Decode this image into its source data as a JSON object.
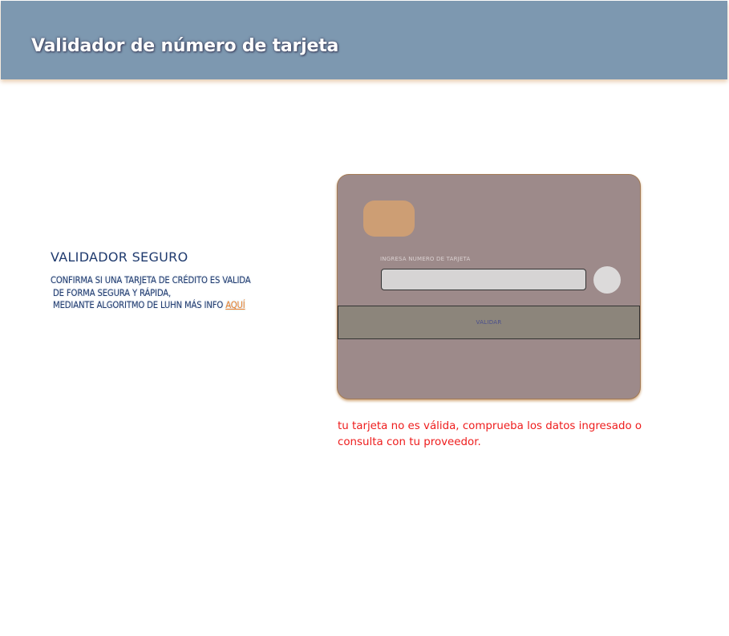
{
  "header": {
    "title": "Validador de número de tarjeta"
  },
  "info": {
    "title": "VALIDADOR SEGURO",
    "line1": "CONFIRMA SI UNA TARJETA DE CRÉDITO ES VALIDA",
    "line2": " DE FORMA SEGURA Y RÁPIDA,",
    "line3": " MEDIANTE ALGORITMO DE LUHN MÁS INFO ",
    "link_label": "AQUÍ"
  },
  "card": {
    "input_label": "INGRESA NUMERO DE TARJETA",
    "input_value": "",
    "input_placeholder": "",
    "button_label": "VALIDAR",
    "colors": {
      "card_bg": "#9d8a8a",
      "chip": "#cd9e74",
      "button_bg": "#8c857b",
      "input_bg": "#d6d4d4"
    }
  },
  "result": {
    "message": "tu tarjeta no es válida, comprueba los datos ingresado o consulta con tu proveedor.",
    "color": "#ee1c1c"
  },
  "colors": {
    "header_bg": "#7d98b0",
    "text_primary": "#1f3a6e",
    "link": "#e8812b"
  }
}
